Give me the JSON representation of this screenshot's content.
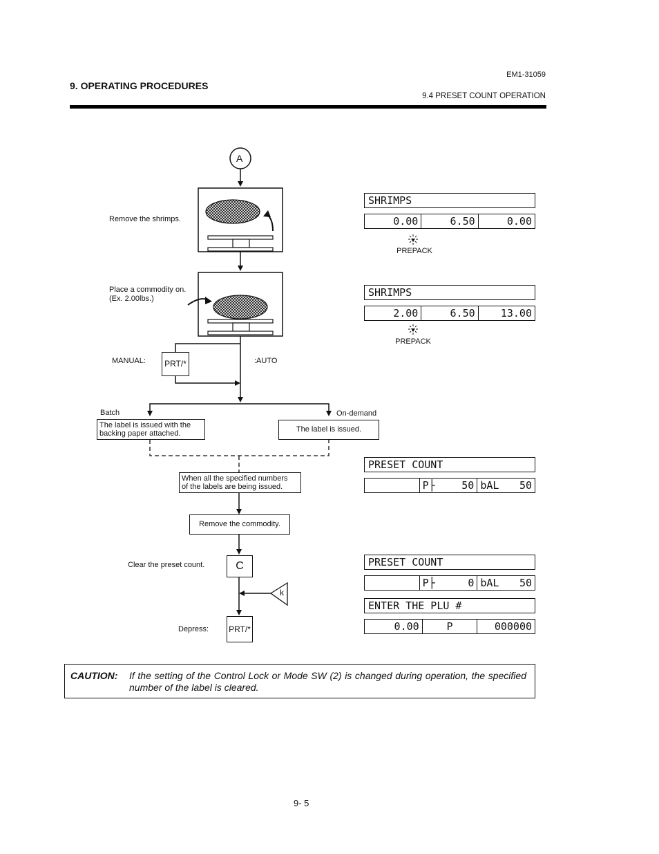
{
  "header": {
    "chapter_title": "9. OPERATING PROCEDURES",
    "document_number": "EM1-31059",
    "section_title": "9.4  PRESET COUNT OPERATION"
  },
  "flow": {
    "connector_label": "A",
    "step_remove_shrimps": "Remove the shrimps.",
    "step_place_commodity_line1": "Place a commodity on.",
    "step_place_commodity_line2": "(Ex. 2.00lbs.)",
    "manual_label": "MANUAL:",
    "auto_label": ":AUTO",
    "prt_key": "PRT/*",
    "batch_label": "Batch",
    "ondemand_label": "On-demand",
    "batch_box_line1": "The label is issued with the",
    "batch_box_line2": "backing paper attached.",
    "ondemand_box": "The label is issued.",
    "all_issued_line1": "When all the specified numbers",
    "all_issued_line2": "of the labels are being issued.",
    "remove_commodity": "Remove the commodity.",
    "clear_preset_label": "Clear the preset count.",
    "clear_key": "C",
    "k_symbol": "k",
    "depress_label": "Depress:",
    "depress_key": "PRT/*"
  },
  "displays": [
    {
      "top": "SHRIMPS",
      "cells": [
        "0.00",
        "6.50",
        "0.00"
      ],
      "indicator": "PREPACK"
    },
    {
      "top": "SHRIMPS",
      "cells": [
        "2.00",
        "6.50",
        "13.00"
      ],
      "indicator": "PREPACK"
    },
    {
      "top": "PRESET COUNT",
      "cells": [
        "",
        {
          "k": "P├",
          "v": "50"
        },
        {
          "k": "bAL",
          "v": "50"
        }
      ]
    },
    {
      "top": "PRESET COUNT",
      "cells": [
        "",
        {
          "k": "P├",
          "v": "0"
        },
        {
          "k": "bAL",
          "v": "50"
        }
      ]
    },
    {
      "top": "ENTER THE PLU #",
      "cells": [
        "0.00",
        "P",
        "000000"
      ]
    }
  ],
  "caution": {
    "label": "CAUTION:",
    "text": "If the setting of the Control Lock or Mode SW (2) is changed during operation, the specified number of the label is cleared."
  },
  "page_number": "9- 5"
}
